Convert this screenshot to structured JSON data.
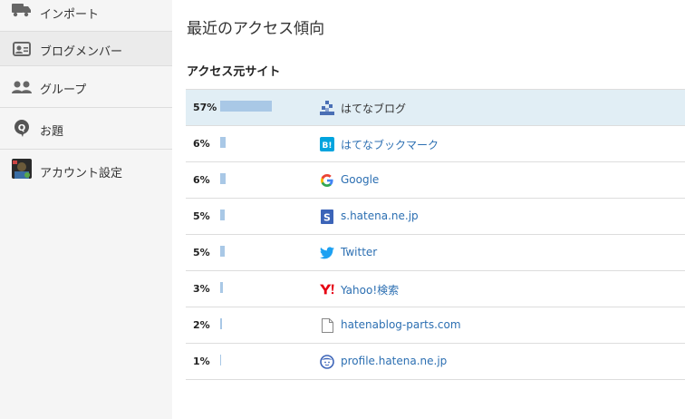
{
  "sidebar": {
    "items": [
      {
        "label": "インポート",
        "icon": "truck-icon"
      },
      {
        "label": "ブログメンバー",
        "icon": "members-card-icon"
      },
      {
        "label": "グループ",
        "icon": "group-icon"
      },
      {
        "label": "お題",
        "icon": "q-bubble-icon"
      },
      {
        "label": "アカウント設定",
        "icon": "avatar-icon"
      }
    ]
  },
  "main": {
    "title": "最近のアクセス傾向",
    "section_title": "アクセス元サイト",
    "rows": [
      {
        "percent_label": "57%",
        "percent": 57,
        "site": "はてなブログ",
        "icon": "hatena-blog-icon"
      },
      {
        "percent_label": "6%",
        "percent": 6,
        "site": "はてなブックマーク",
        "icon": "hatena-bookmark-icon"
      },
      {
        "percent_label": "6%",
        "percent": 6,
        "site": "Google",
        "icon": "google-icon"
      },
      {
        "percent_label": "5%",
        "percent": 5,
        "site": "s.hatena.ne.jp",
        "icon": "hatena-s-icon"
      },
      {
        "percent_label": "5%",
        "percent": 5,
        "site": "Twitter",
        "icon": "twitter-icon"
      },
      {
        "percent_label": "3%",
        "percent": 3,
        "site": "Yahoo!検索",
        "icon": "yahoo-icon"
      },
      {
        "percent_label": "2%",
        "percent": 2,
        "site": "hatenablog-parts.com",
        "icon": "document-icon"
      },
      {
        "percent_label": "1%",
        "percent": 1,
        "site": "profile.hatena.ne.jp",
        "icon": "profile-face-icon"
      }
    ]
  },
  "colors": {
    "bar": "#a9c8e6",
    "link": "#2c6fb2",
    "highlight_row": "#e1eef5",
    "sidebar_bg": "#f5f5f5"
  }
}
